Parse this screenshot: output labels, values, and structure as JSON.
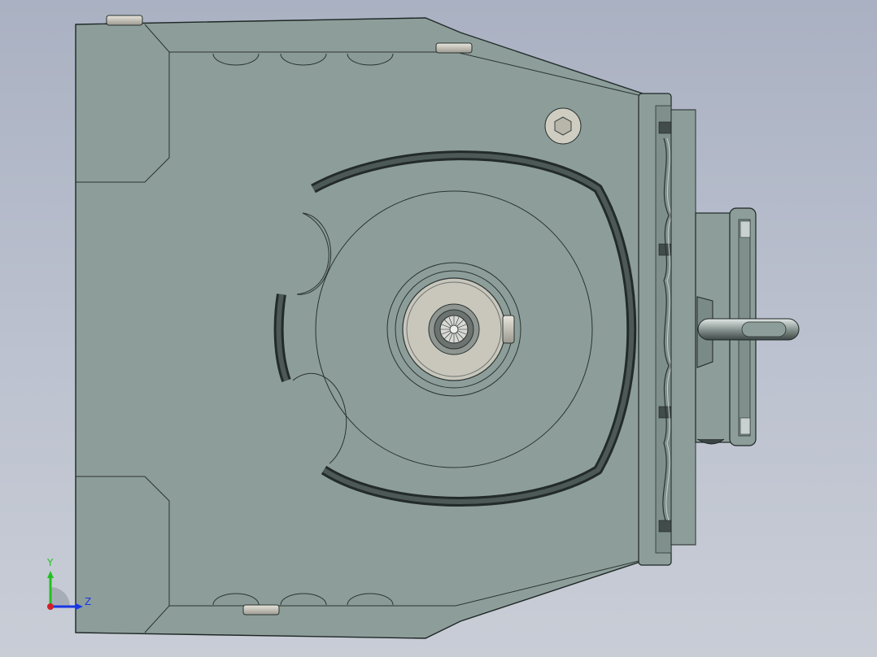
{
  "viewport": {
    "background_top": "#aab1c2",
    "background_bottom": "#c9cdd6"
  },
  "model": {
    "housing_color": "#8d9e9a",
    "edge_color": "#1e2624",
    "groove_color": "#3f4948",
    "bolt_color": "#cfcdc2",
    "shaft_color": "#c9c7bc"
  },
  "triad": {
    "y_label": "Y",
    "z_label": "Z",
    "y_color": "#22c022",
    "z_color": "#1a36e6",
    "x_color": "#d0202a"
  }
}
